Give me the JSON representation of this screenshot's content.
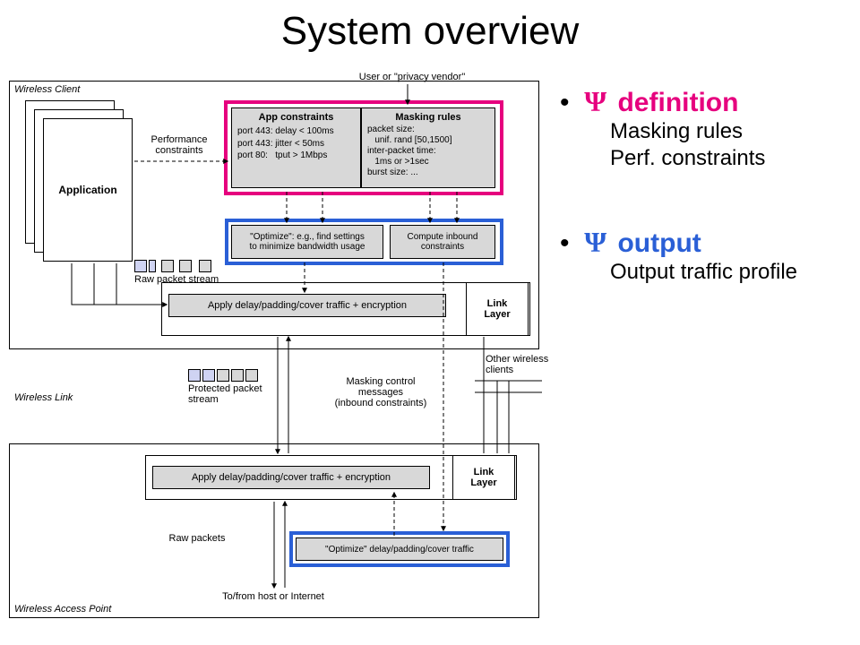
{
  "title": "System overview",
  "diagram": {
    "outer_top_label": "Wireless Client",
    "user_vendor": "User or \"privacy vendor\"",
    "application": "Application",
    "perf_constraints": "Performance\nconstraints",
    "app_constraints_title": "App constraints",
    "app_constraints_lines": "port 443: delay < 100ms\nport 443: jitter < 50ms\nport 80:   tput > 1Mbps",
    "masking_title": "Masking rules",
    "masking_lines": "packet size:\n   unif. rand [50,1500]\ninter-packet time:\n   1ms or >1sec\nburst size: ...",
    "optimize_min": "\"Optimize\": e.g., find settings\nto minimize bandwidth usage",
    "compute_inbound": "Compute inbound\nconstraints",
    "raw_stream": "Raw packet stream",
    "apply_top": "Apply delay/padding/cover traffic + encryption",
    "link_layer": "Link\nLayer",
    "protected_stream": "Protected packet\nstream",
    "wireless_link": "Wireless Link",
    "masking_ctrl": "Masking control\nmessages\n(inbound constraints)",
    "other_clients": "Other wireless\nclients",
    "apply_bottom": "Apply delay/padding/cover traffic + encryption",
    "optimize_bottom": "\"Optimize\" delay/padding/cover traffic",
    "raw_packets": "Raw packets",
    "tofrom": "To/from host or Internet",
    "outer_bottom_label": "Wireless Access Point"
  },
  "bullets": {
    "b1_head": "definition",
    "b1_sub1": "Masking rules",
    "b1_sub2": "Perf. constraints",
    "b2_head": "output",
    "b2_sub1": "Output traffic profile"
  }
}
